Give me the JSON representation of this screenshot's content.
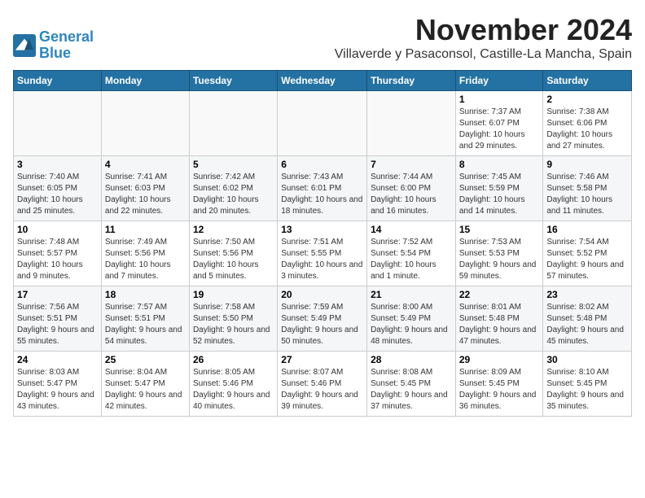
{
  "logo": {
    "line1": "General",
    "line2": "Blue"
  },
  "header": {
    "month_title": "November 2024",
    "location": "Villaverde y Pasaconsol, Castille-La Mancha, Spain"
  },
  "weekdays": [
    "Sunday",
    "Monday",
    "Tuesday",
    "Wednesday",
    "Thursday",
    "Friday",
    "Saturday"
  ],
  "weeks": [
    [
      {
        "day": "",
        "info": ""
      },
      {
        "day": "",
        "info": ""
      },
      {
        "day": "",
        "info": ""
      },
      {
        "day": "",
        "info": ""
      },
      {
        "day": "",
        "info": ""
      },
      {
        "day": "1",
        "info": "Sunrise: 7:37 AM\nSunset: 6:07 PM\nDaylight: 10 hours and 29 minutes."
      },
      {
        "day": "2",
        "info": "Sunrise: 7:38 AM\nSunset: 6:06 PM\nDaylight: 10 hours and 27 minutes."
      }
    ],
    [
      {
        "day": "3",
        "info": "Sunrise: 7:40 AM\nSunset: 6:05 PM\nDaylight: 10 hours and 25 minutes."
      },
      {
        "day": "4",
        "info": "Sunrise: 7:41 AM\nSunset: 6:03 PM\nDaylight: 10 hours and 22 minutes."
      },
      {
        "day": "5",
        "info": "Sunrise: 7:42 AM\nSunset: 6:02 PM\nDaylight: 10 hours and 20 minutes."
      },
      {
        "day": "6",
        "info": "Sunrise: 7:43 AM\nSunset: 6:01 PM\nDaylight: 10 hours and 18 minutes."
      },
      {
        "day": "7",
        "info": "Sunrise: 7:44 AM\nSunset: 6:00 PM\nDaylight: 10 hours and 16 minutes."
      },
      {
        "day": "8",
        "info": "Sunrise: 7:45 AM\nSunset: 5:59 PM\nDaylight: 10 hours and 14 minutes."
      },
      {
        "day": "9",
        "info": "Sunrise: 7:46 AM\nSunset: 5:58 PM\nDaylight: 10 hours and 11 minutes."
      }
    ],
    [
      {
        "day": "10",
        "info": "Sunrise: 7:48 AM\nSunset: 5:57 PM\nDaylight: 10 hours and 9 minutes."
      },
      {
        "day": "11",
        "info": "Sunrise: 7:49 AM\nSunset: 5:56 PM\nDaylight: 10 hours and 7 minutes."
      },
      {
        "day": "12",
        "info": "Sunrise: 7:50 AM\nSunset: 5:56 PM\nDaylight: 10 hours and 5 minutes."
      },
      {
        "day": "13",
        "info": "Sunrise: 7:51 AM\nSunset: 5:55 PM\nDaylight: 10 hours and 3 minutes."
      },
      {
        "day": "14",
        "info": "Sunrise: 7:52 AM\nSunset: 5:54 PM\nDaylight: 10 hours and 1 minute."
      },
      {
        "day": "15",
        "info": "Sunrise: 7:53 AM\nSunset: 5:53 PM\nDaylight: 9 hours and 59 minutes."
      },
      {
        "day": "16",
        "info": "Sunrise: 7:54 AM\nSunset: 5:52 PM\nDaylight: 9 hours and 57 minutes."
      }
    ],
    [
      {
        "day": "17",
        "info": "Sunrise: 7:56 AM\nSunset: 5:51 PM\nDaylight: 9 hours and 55 minutes."
      },
      {
        "day": "18",
        "info": "Sunrise: 7:57 AM\nSunset: 5:51 PM\nDaylight: 9 hours and 54 minutes."
      },
      {
        "day": "19",
        "info": "Sunrise: 7:58 AM\nSunset: 5:50 PM\nDaylight: 9 hours and 52 minutes."
      },
      {
        "day": "20",
        "info": "Sunrise: 7:59 AM\nSunset: 5:49 PM\nDaylight: 9 hours and 50 minutes."
      },
      {
        "day": "21",
        "info": "Sunrise: 8:00 AM\nSunset: 5:49 PM\nDaylight: 9 hours and 48 minutes."
      },
      {
        "day": "22",
        "info": "Sunrise: 8:01 AM\nSunset: 5:48 PM\nDaylight: 9 hours and 47 minutes."
      },
      {
        "day": "23",
        "info": "Sunrise: 8:02 AM\nSunset: 5:48 PM\nDaylight: 9 hours and 45 minutes."
      }
    ],
    [
      {
        "day": "24",
        "info": "Sunrise: 8:03 AM\nSunset: 5:47 PM\nDaylight: 9 hours and 43 minutes."
      },
      {
        "day": "25",
        "info": "Sunrise: 8:04 AM\nSunset: 5:47 PM\nDaylight: 9 hours and 42 minutes."
      },
      {
        "day": "26",
        "info": "Sunrise: 8:05 AM\nSunset: 5:46 PM\nDaylight: 9 hours and 40 minutes."
      },
      {
        "day": "27",
        "info": "Sunrise: 8:07 AM\nSunset: 5:46 PM\nDaylight: 9 hours and 39 minutes."
      },
      {
        "day": "28",
        "info": "Sunrise: 8:08 AM\nSunset: 5:45 PM\nDaylight: 9 hours and 37 minutes."
      },
      {
        "day": "29",
        "info": "Sunrise: 8:09 AM\nSunset: 5:45 PM\nDaylight: 9 hours and 36 minutes."
      },
      {
        "day": "30",
        "info": "Sunrise: 8:10 AM\nSunset: 5:45 PM\nDaylight: 9 hours and 35 minutes."
      }
    ]
  ]
}
